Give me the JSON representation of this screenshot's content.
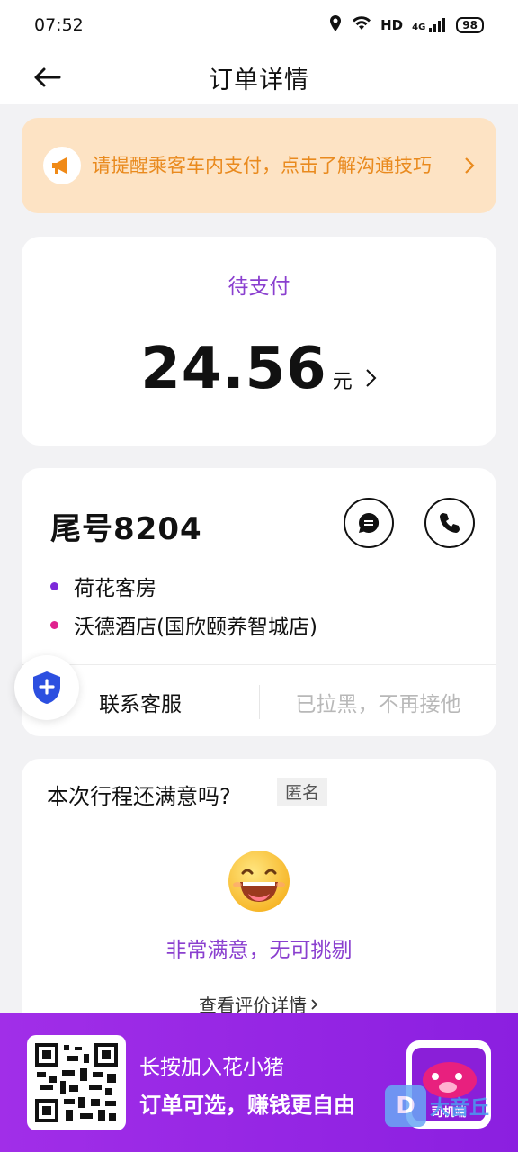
{
  "status_bar": {
    "time": "07:52",
    "network": "HD",
    "signal": "4G",
    "battery": "98"
  },
  "header": {
    "title": "订单详情"
  },
  "notice": {
    "text": "请提醒乘客车内支付，点击了解沟通技巧",
    "color": "#e98a1e"
  },
  "payment": {
    "status": "待支付",
    "amount": "24.56",
    "unit": "元"
  },
  "passenger": {
    "tail_number": "尾号8204",
    "pickup": "荷花客房",
    "dropoff": "沃德酒店(国欣颐养智城店)",
    "contact_label": "联系客服",
    "blacklist_label": "已拉黑，不再接他"
  },
  "rating": {
    "question": "本次行程还满意吗?",
    "anonymous_label": "匿名",
    "result": "非常满意，无可挑剔",
    "detail_link": "查看评价详情"
  },
  "promo": {
    "line1": "长按加入花小猪",
    "line2": "订单可选，赚钱更自由",
    "app_label": "司机端"
  },
  "watermark": {
    "text": "大音丘"
  },
  "colors": {
    "accent": "#8a3fcf",
    "promo_bg": "#9a27e6",
    "notice_bg": "#fde3c4"
  }
}
